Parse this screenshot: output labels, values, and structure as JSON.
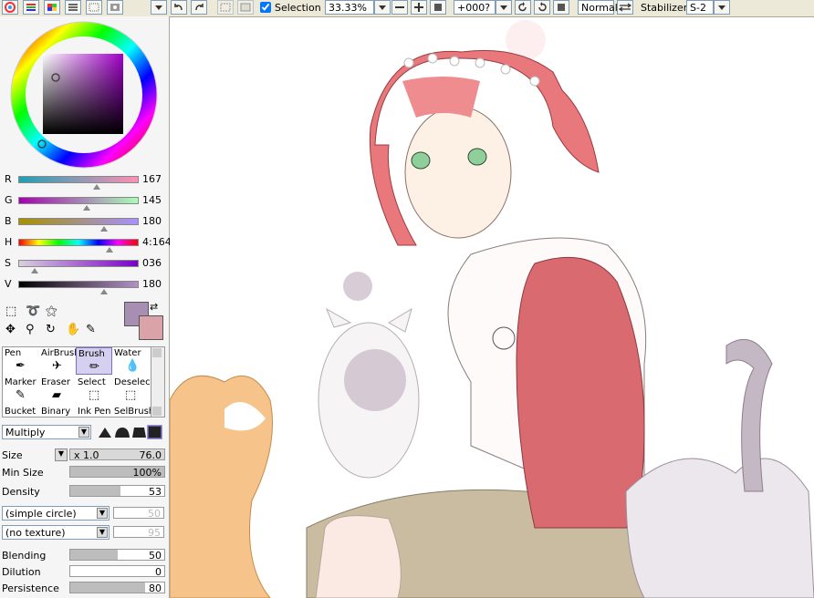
{
  "toolbar": {
    "selection_label": "Selection",
    "selection_checked": true,
    "zoom": "33.33%",
    "rotation": "+000?",
    "blend_mode": "Normal",
    "stabilizer_label": "Stabilizer",
    "stabilizer_value": "S-2"
  },
  "color": {
    "sliders": [
      {
        "label": "R",
        "value": "167",
        "level": 0.65
      },
      {
        "label": "G",
        "value": "145",
        "level": 0.57
      },
      {
        "label": "B",
        "value": "180",
        "level": 0.71
      },
      {
        "label": "H",
        "value": "4:164",
        "level": 0.76
      },
      {
        "label": "S",
        "value": "036",
        "level": 0.14
      },
      {
        "label": "V",
        "value": "180",
        "level": 0.71
      }
    ],
    "primary": "#a78fb4",
    "secondary": "#d9a3a8"
  },
  "tools": [
    {
      "label": "Pen",
      "icon": "pen-icon",
      "selected": false
    },
    {
      "label": "AirBrush",
      "icon": "airbrush-icon",
      "selected": false
    },
    {
      "label": "Brush",
      "icon": "brush-icon",
      "selected": true
    },
    {
      "label": "Water",
      "icon": "water-icon",
      "selected": false
    },
    {
      "label": "Marker",
      "icon": "marker-icon",
      "selected": false
    },
    {
      "label": "Eraser",
      "icon": "eraser-icon",
      "selected": false
    },
    {
      "label": "Select",
      "icon": "select-icon",
      "selected": false
    },
    {
      "label": "Deselect",
      "icon": "deselect-icon",
      "selected": false
    },
    {
      "label": "Bucket",
      "icon": "bucket-icon",
      "selected": false
    },
    {
      "label": "Binary",
      "icon": "binary-icon",
      "selected": false
    },
    {
      "label": "Ink Pen",
      "icon": "ink-pen-icon",
      "selected": false
    },
    {
      "label": "SelBrush",
      "icon": "selbrush-icon",
      "selected": false
    }
  ],
  "brush": {
    "mode": "Multiply",
    "size_label": "Size",
    "size_multiplier": "x 1.0",
    "size_value": "76.0",
    "min_size_label": "Min Size",
    "min_size_value": "100%",
    "min_size_level": 1.0,
    "density_label": "Density",
    "density_value": "53",
    "density_level": 0.53,
    "shape": "(simple circle)",
    "shape_value": "50",
    "texture": "(no texture)",
    "texture_value": "95",
    "blending_label": "Blending",
    "blending_value": "50",
    "blending_level": 0.5,
    "dilution_label": "Dilution",
    "dilution_value": "0",
    "dilution_level": 0.0,
    "persistence_label": "Persistence",
    "persistence_value": "80",
    "persistence_level": 0.8
  }
}
